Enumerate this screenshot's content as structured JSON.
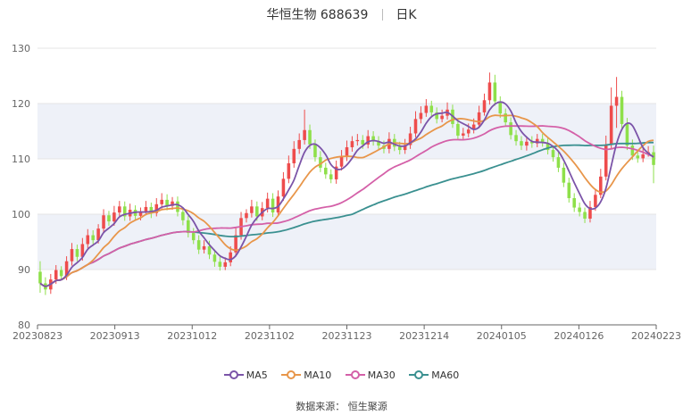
{
  "header": {
    "stock": "华恒生物 688639",
    "period": "日K"
  },
  "source": "数据来源： 恒生聚源",
  "colors": {
    "up": "#ee4c4c",
    "down": "#8ee04a",
    "MA5": "#7b54a8",
    "MA10": "#e8964a",
    "MA30": "#d460a8",
    "MA60": "#3a9090",
    "band": "#eef1f8",
    "grid": "#e4e4e4"
  },
  "chart_data": {
    "type": "candlestick",
    "title": "华恒生物 688639 日K",
    "ylim": [
      80,
      130
    ],
    "yticks": [
      80,
      90,
      100,
      110,
      120,
      130
    ],
    "xticks": [
      "20230823",
      "20230913",
      "20231012",
      "20231102",
      "20231123",
      "20231214",
      "20240105",
      "20240126",
      "20240223"
    ],
    "legend": [
      "MA5",
      "MA10",
      "MA30",
      "MA60"
    ],
    "close": [
      87.5,
      86.4,
      88.2,
      89.9,
      88.8,
      91.5,
      93.7,
      92.3,
      94.6,
      96.2,
      95.3,
      97.4,
      99.8,
      98.7,
      100.3,
      101.4,
      99.6,
      100.8,
      99.7,
      100.5,
      101.3,
      100.2,
      101.8,
      102.6,
      101.5,
      102.3,
      100.4,
      98.9,
      96.6,
      95.3,
      93.6,
      94.2,
      92.7,
      91.4,
      90.5,
      91.3,
      93.1,
      96.2,
      99.3,
      100.2,
      101.4,
      99.6,
      101.1,
      102.8,
      100.3,
      103.2,
      106.4,
      109.2,
      111.8,
      113.4,
      115.2,
      112.6,
      110.3,
      108.4,
      107.2,
      106.3,
      108.6,
      110.4,
      112.1,
      113.2,
      113.4,
      112.6,
      114.1,
      113.2,
      112.4,
      111.8,
      113.6,
      112.2,
      111.6,
      112.5,
      114.6,
      117.2,
      118.3,
      119.6,
      118.4,
      117.2,
      117.8,
      118.9,
      116.3,
      114.2,
      114.6,
      115.3,
      116.2,
      118.4,
      120.6,
      123.8,
      120.4,
      118.2,
      116.6,
      114.3,
      113.2,
      112.4,
      113.1,
      112.8,
      113.6,
      112.9,
      111.6,
      110.3,
      108.4,
      105.7,
      102.9,
      101.2,
      100.4,
      99.2,
      101.3,
      103.5,
      106.8,
      112.6,
      119.6,
      121.2,
      116.3,
      112.4,
      110.6,
      110.1,
      110.8,
      111.2,
      108.9
    ],
    "open": [
      89.6,
      87.5,
      86.4,
      88.2,
      89.9,
      88.8,
      91.5,
      93.7,
      92.3,
      94.6,
      96.2,
      95.3,
      97.4,
      99.8,
      98.7,
      100.3,
      101.4,
      99.6,
      100.8,
      99.7,
      100.5,
      101.3,
      100.2,
      101.8,
      102.6,
      101.5,
      102.3,
      100.4,
      98.9,
      96.6,
      95.3,
      93.6,
      94.2,
      92.7,
      91.4,
      90.5,
      91.3,
      93.1,
      96.2,
      99.3,
      100.2,
      101.4,
      99.6,
      101.1,
      102.8,
      100.3,
      103.2,
      106.4,
      109.2,
      111.8,
      113.4,
      115.2,
      112.6,
      110.3,
      108.4,
      107.2,
      106.3,
      108.6,
      110.4,
      112.1,
      113.2,
      113.4,
      112.6,
      114.1,
      113.2,
      112.4,
      111.8,
      113.6,
      112.2,
      111.6,
      112.5,
      114.6,
      117.2,
      118.3,
      119.6,
      118.4,
      117.2,
      117.8,
      118.9,
      116.3,
      114.2,
      114.6,
      115.3,
      116.2,
      118.4,
      120.6,
      123.8,
      120.4,
      118.2,
      116.6,
      114.3,
      113.2,
      112.4,
      113.1,
      112.8,
      113.6,
      112.9,
      111.6,
      110.3,
      108.4,
      105.7,
      102.9,
      101.2,
      100.4,
      99.2,
      101.3,
      103.5,
      106.8,
      112.6,
      119.6,
      121.2,
      116.3,
      112.4,
      110.6,
      110.1,
      110.8,
      111.2
    ],
    "high": [
      91.5,
      88.6,
      89.2,
      90.8,
      90.6,
      92.4,
      94.8,
      94.5,
      95.7,
      97.3,
      97.1,
      98.2,
      100.9,
      100.6,
      101.5,
      102.4,
      102.3,
      101.9,
      101.6,
      101.2,
      102.4,
      102.1,
      102.9,
      103.8,
      103.6,
      103.1,
      103.2,
      101.3,
      99.7,
      97.5,
      96.2,
      95.3,
      95.2,
      93.6,
      92.3,
      92.2,
      94.2,
      97.6,
      100.4,
      100.9,
      102.6,
      102.3,
      102.2,
      103.9,
      103.8,
      104.3,
      107.6,
      110.6,
      113.2,
      114.6,
      118.9,
      116.2,
      113.5,
      111.4,
      109.3,
      108.1,
      109.7,
      111.6,
      113.3,
      114.1,
      114.5,
      114.3,
      115.2,
      115.0,
      114.1,
      113.3,
      114.8,
      114.5,
      113.1,
      113.6,
      115.8,
      118.6,
      119.5,
      120.8,
      120.5,
      119.3,
      118.9,
      120.2,
      119.8,
      117.3,
      115.6,
      116.4,
      117.3,
      119.6,
      121.8,
      125.6,
      125.2,
      121.3,
      119.1,
      117.5,
      115.2,
      114.1,
      114.0,
      114.1,
      114.5,
      114.5,
      113.8,
      112.4,
      111.2,
      109.3,
      106.6,
      103.8,
      102.1,
      101.2,
      102.4,
      104.6,
      108.2,
      114.2,
      122.9,
      124.8,
      122.3,
      117.4,
      113.5,
      111.6,
      111.9,
      112.3,
      112.4
    ],
    "low": [
      85.8,
      85.4,
      85.6,
      87.4,
      88.0,
      88.1,
      90.7,
      91.5,
      91.6,
      93.8,
      94.6,
      94.7,
      96.6,
      97.9,
      97.9,
      99.6,
      98.8,
      98.8,
      99.0,
      98.9,
      99.8,
      99.3,
      99.6,
      101.0,
      100.7,
      100.8,
      99.6,
      98.0,
      95.8,
      94.6,
      92.8,
      92.9,
      91.9,
      90.5,
      89.8,
      89.9,
      90.6,
      92.3,
      95.4,
      98.5,
      99.4,
      98.8,
      98.9,
      100.3,
      99.5,
      99.6,
      102.4,
      105.6,
      108.4,
      110.9,
      112.6,
      111.8,
      109.5,
      107.6,
      106.4,
      105.6,
      105.5,
      107.9,
      109.6,
      111.3,
      112.4,
      111.8,
      111.9,
      112.4,
      111.6,
      111.0,
      111.0,
      111.4,
      110.8,
      110.9,
      111.8,
      113.9,
      116.4,
      117.6,
      117.6,
      116.4,
      116.6,
      117.1,
      115.6,
      113.4,
      113.5,
      113.9,
      114.6,
      115.5,
      117.8,
      119.8,
      119.6,
      117.4,
      115.8,
      113.5,
      112.4,
      111.6,
      111.5,
      112.0,
      112.1,
      112.2,
      110.8,
      109.5,
      107.6,
      104.9,
      102.1,
      100.4,
      99.6,
      98.4,
      98.5,
      100.6,
      102.9,
      106.1,
      111.8,
      115.6,
      115.5,
      111.6,
      109.8,
      109.3,
      109.4,
      110.4,
      105.6
    ]
  }
}
